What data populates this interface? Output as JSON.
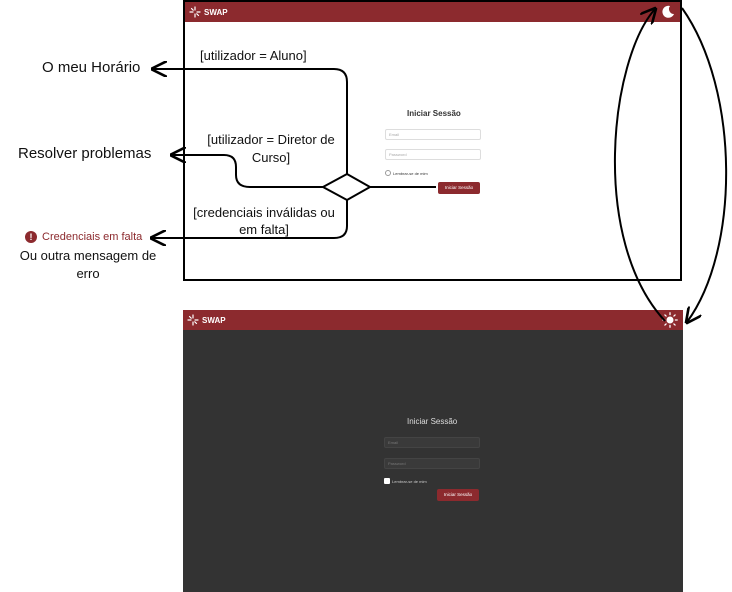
{
  "app": {
    "brand": "SWAP"
  },
  "light": {
    "title": "Iniciar Sessão",
    "email_placeholder": "Email",
    "password_placeholder": "Password",
    "remember": "Lembrar-se de mim",
    "submit": "Iniciar Sessão",
    "theme_icon": "moon-icon"
  },
  "dark": {
    "title": "Iniciar Sessão",
    "email_placeholder": "Email",
    "password_placeholder": "Password",
    "remember": "Lembrar-se de mim",
    "submit": "Iniciar Sessão",
    "theme_icon": "sun-icon"
  },
  "flow": {
    "cond_aluno": "[utilizador = Aluno]",
    "cond_diretor": "[utilizador = Diretor de Curso]",
    "cond_erro": "[credenciais inválidas ou em falta]",
    "dest_aluno": "O meu Horário",
    "dest_diretor": "Resolver problemas",
    "dest_erro_badge": "Credenciais em falta",
    "dest_erro_note": "Ou outra mensagem de erro"
  },
  "colors": {
    "brand": "#8c2a2e",
    "dark_bg": "#333333"
  }
}
